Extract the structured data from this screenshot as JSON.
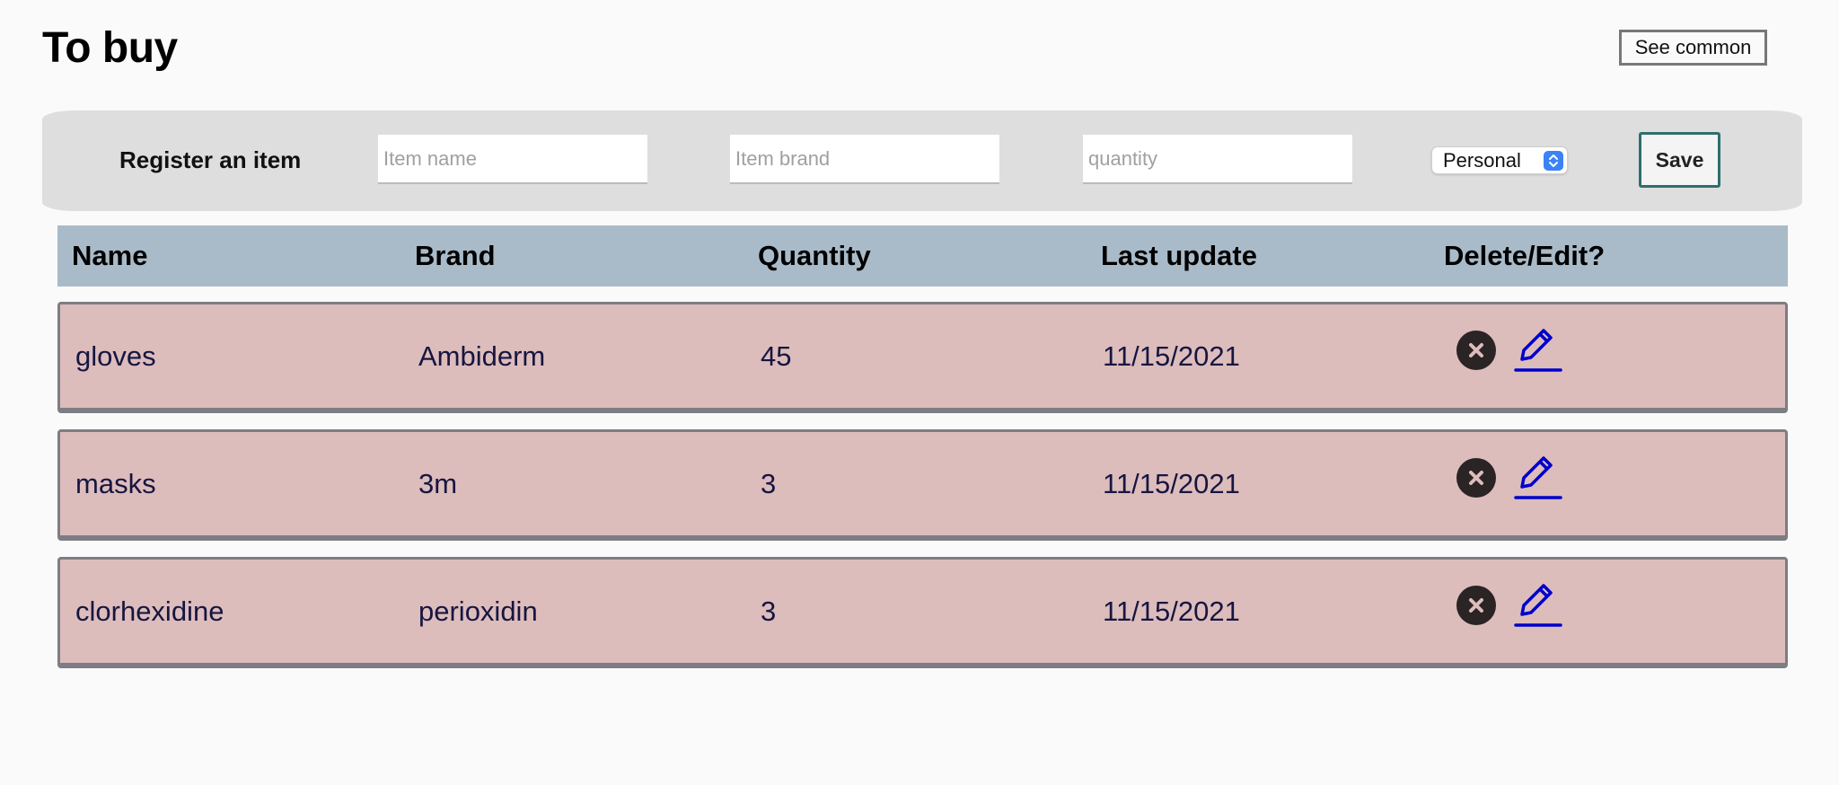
{
  "page": {
    "title": "To buy"
  },
  "header": {
    "see_common_label": "See common"
  },
  "register": {
    "label": "Register an item",
    "name_placeholder": "Item name",
    "brand_placeholder": "Item brand",
    "quantity_placeholder": "quantity",
    "category_selected": "Personal",
    "save_label": "Save"
  },
  "table": {
    "columns": [
      "Name",
      "Brand",
      "Quantity",
      "Last update",
      "Delete/Edit?"
    ],
    "rows": [
      {
        "name": "gloves",
        "brand": "Ambiderm",
        "quantity": "45",
        "last_update": "11/15/2021"
      },
      {
        "name": "masks",
        "brand": "3m",
        "quantity": "3",
        "last_update": "11/15/2021"
      },
      {
        "name": "clorhexidine",
        "brand": "perioxidin",
        "quantity": "3",
        "last_update": "11/15/2021"
      }
    ]
  },
  "icons": {
    "delete": "close-circle-icon",
    "edit": "pencil-icon",
    "select_stepper": "chevron-up-down-icon"
  },
  "colors": {
    "header_bg": "#a9bbc9",
    "row_bg": "#ddbcbc",
    "row_text": "#161640",
    "edit_icon": "#0000cc",
    "delete_icon": "#2a2424",
    "save_border": "#2f6e6e",
    "select_accent": "#3b82f6"
  }
}
